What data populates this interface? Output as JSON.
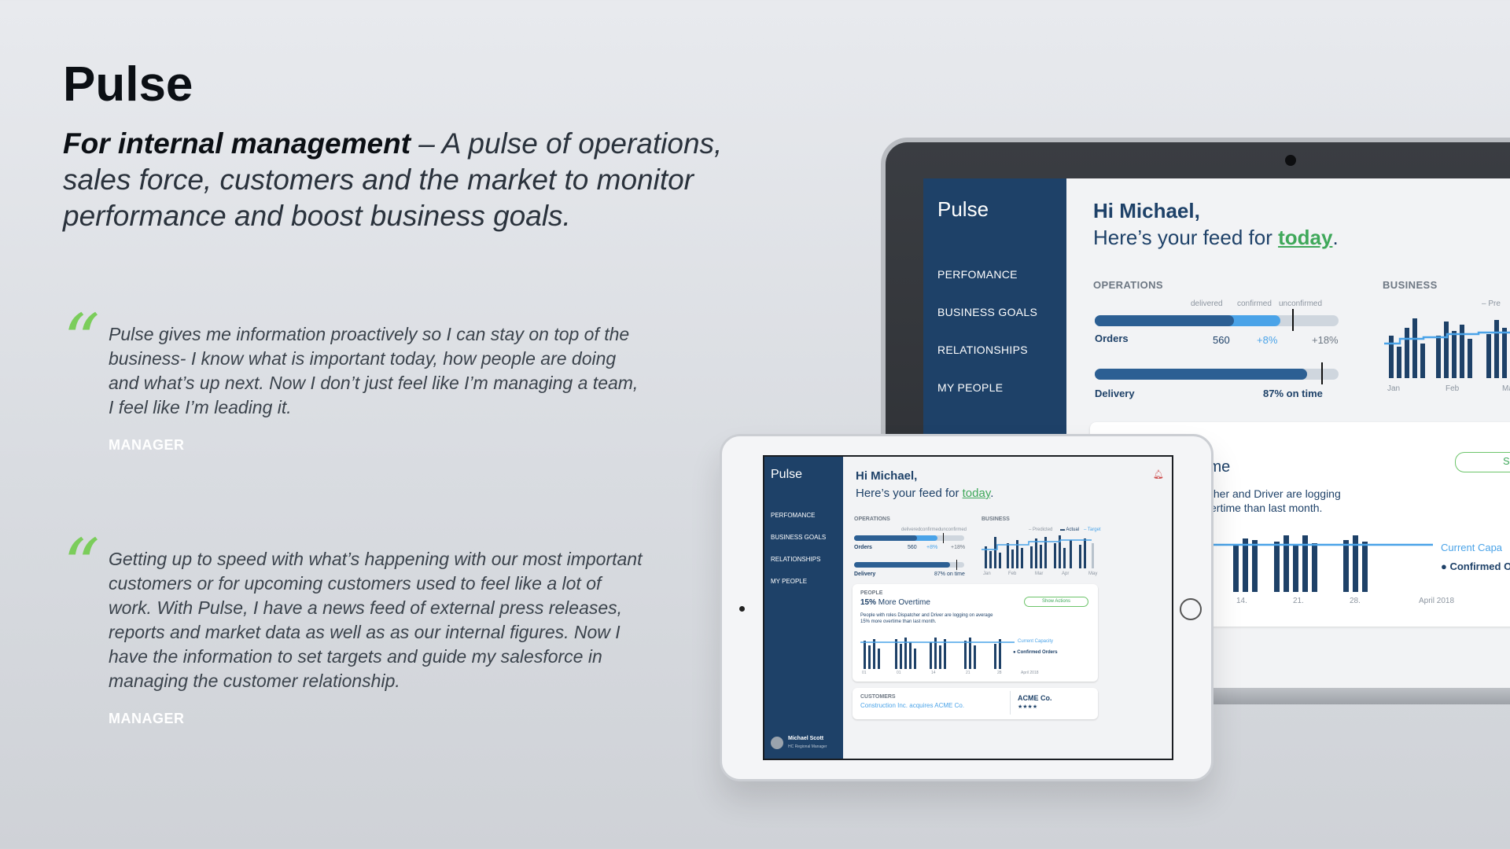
{
  "headline": "Pulse",
  "lede": {
    "bold": "For internal management",
    "rest": " – A pulse of operations, sales force, customers and the market to monitor performance and boost business goals."
  },
  "quotes": [
    {
      "mark": "“",
      "text": "Pulse gives me information proactively so I can stay on top of the business- I know what is important today, how people are doing and what’s up next. Now I don’t just feel like I’m managing a team, I feel like I’m leading it.",
      "role": "MANAGER"
    },
    {
      "mark": "“",
      "text": "Getting up to speed with what’s happening with our most important customers or for upcoming customers used to feel like a lot of work. With Pulse, I have a news feed of external press releases, reports and market data as well as as our internal figures. Now I have the information to set targets and guide my salesforce in managing the customer relationship.",
      "role": "MANAGER"
    }
  ],
  "app": {
    "brand": "Pulse",
    "nav": [
      "PERFOMANCE",
      "BUSINESS GOALS",
      "RELATIONSHIPS",
      "MY PEOPLE"
    ],
    "greeting": "Hi Michael,",
    "feed_prefix": "Here’s your feed for ",
    "feed_today": "today",
    "feed_suffix": ".",
    "operations_title": "OPERATIONS",
    "business_title": "BUSINESS",
    "legend_delivered": "delivered",
    "legend_confirmed": "confirmed",
    "legend_unconfirmed": "unconfirmed",
    "orders_label": "Orders",
    "orders_value": "560",
    "orders_confirmed": "+8%",
    "orders_unconfirmed": "+18%",
    "orders_delivered_fraction": 0.57,
    "orders_confirmed_fraction": 0.76,
    "orders_target_fraction": 0.81,
    "delivery_label": "Delivery",
    "delivery_value": "87% on time",
    "delivery_fraction": 0.87,
    "delivery_target_fraction": 0.93,
    "business_legend": [
      "Predicted",
      "Actual",
      "Target"
    ],
    "business_legend_laptop_partial": "Pre",
    "business_months": [
      "Jan",
      "Feb",
      "Mar",
      "Apr",
      "May"
    ],
    "people_title": "PEOPLE",
    "people_headline_pct": "15%",
    "people_headline_rest": " More Overtime",
    "people_headline_laptop_partial": "ime",
    "people_desc": "People with roles Dispatcher and Driver are logging on average 15% more overtime than last month.",
    "people_desc_laptop_partial_1": "tcher and Driver are logging",
    "people_desc_laptop_partial_2": "vertime than last month.",
    "show_actions": "Show Actions",
    "show_actions_laptop_partial": "S",
    "capacity_legend": "Current Capacity",
    "capacity_legend_laptop_partial": "Current Capa",
    "confirmed_legend": "Confirmed Orders",
    "confirmed_legend_laptop_partial": "Confirmed O",
    "people_axis": [
      "01",
      "01",
      "14",
      "21",
      "28",
      "April 2018"
    ],
    "people_axis_laptop": [
      "14.",
      "21.",
      "28.",
      "April 2018"
    ],
    "customers_title": "CUSTOMERS",
    "customers_news": "Construction Inc. acquires ACME Co.",
    "customer_name": "ACME Co.",
    "customer_stars": "★★★★",
    "user_name": "Michael Scott",
    "user_role": "HC Regional Manager"
  },
  "colors": {
    "navy": "#1e4168",
    "accent_blue": "#4aa3e8",
    "green": "#3fa85a",
    "quote_mark": "#7bcd5b"
  }
}
